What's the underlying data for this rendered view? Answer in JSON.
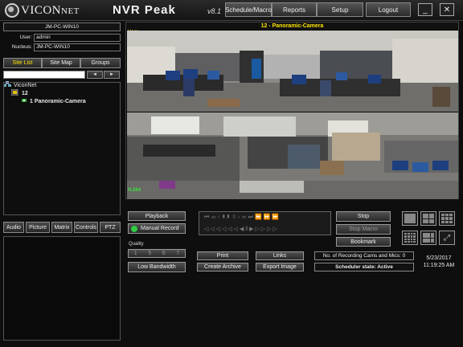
{
  "header": {
    "logo_main": "VICON",
    "logo_suffix": "NET",
    "app_title": "NVR Peak",
    "version": "v8.1",
    "buttons": {
      "schedule": "Schedule/Macro",
      "reports": "Reports",
      "setup": "Setup",
      "logout": "Logout"
    },
    "window_controls": {
      "minimize": "_",
      "close": "✕"
    }
  },
  "session": {
    "computer": "JM-PC-WIN10",
    "user_label": "User:",
    "user": "admin",
    "nucleus_label": "Nucleus:",
    "nucleus": "JM-PC-WIN10"
  },
  "site_tabs": [
    "Site List",
    "Site Map",
    "Groups"
  ],
  "active_site_tab": "Site List",
  "search": {
    "value": "",
    "prev": "◄",
    "next": "►"
  },
  "tree": {
    "root": "ViconNet",
    "server": "12",
    "camera": "1  Panoramic-Camera"
  },
  "panel_tabs": [
    "Audio",
    "Picture",
    "Matrix",
    "Controls",
    "PTZ"
  ],
  "video": {
    "camera_title": "12 - Panoramic-Camera",
    "overlay_user": "User",
    "overlay_codec": "H.264"
  },
  "controls": {
    "playback": "Playback",
    "manual_record": "Manual Record",
    "quality_label": "Quality",
    "quality_levels": [
      "1",
      "5",
      "6",
      "7"
    ],
    "low_bandwidth": "Low Bandwidth",
    "print": "Print",
    "create_archive": "Create Archive",
    "links": "Links",
    "export_image": "Export Image",
    "stop": "Stop",
    "stop_macro": "Stop Macro",
    "bookmark": "Bookmark",
    "recording_count": "No. of Recording Cams and Mics: 0",
    "scheduler_state": "Scheduler state: Active",
    "date": "5/23/2017",
    "time": "11:19:25 AM"
  },
  "colors": {
    "accent_yellow": "#ffe400",
    "record_green": "#2ecc40",
    "background": "#0e0e0e"
  }
}
